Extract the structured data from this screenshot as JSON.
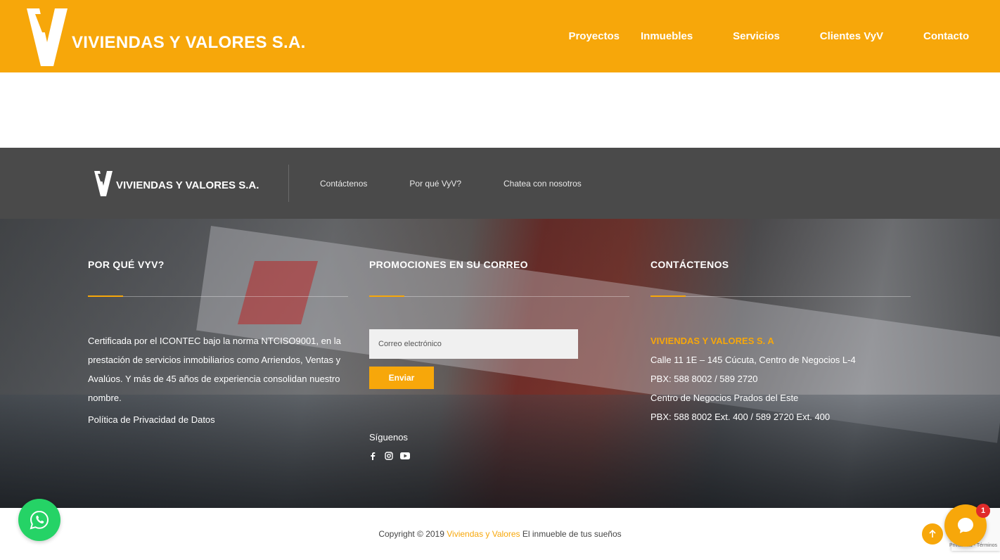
{
  "header": {
    "brand": "VIVIENDAS Y VALORES S.A.",
    "nav": [
      {
        "label": "Proyectos"
      },
      {
        "label": "Inmuebles"
      },
      {
        "label": "Servicios"
      },
      {
        "label": "Clientes VyV"
      },
      {
        "label": "Contacto"
      }
    ]
  },
  "footer_bar": {
    "brand": "VIVIENDAS Y VALORES S.A.",
    "links": [
      "Contáctenos",
      "Por qué VyV?",
      "Chatea con nosotros"
    ]
  },
  "about": {
    "title": "POR QUÉ VYV?",
    "text": "Certificada por el ICONTEC bajo la norma NTCISO9001, en la prestación de servicios inmobiliarios como Arriendos, Ventas y Avalúos. Y más de 45 años de experiencia consolidan nuestro nombre.",
    "privacy_link": "Política de Privacidad de Datos"
  },
  "newsletter": {
    "title": "PROMOCIONES EN SU CORREO",
    "email_placeholder": "Correo electrónico",
    "submit_label": "Enviar",
    "follow_label": "Síguenos",
    "socials": [
      "facebook",
      "instagram",
      "youtube"
    ]
  },
  "contact": {
    "title": "CONTÁCTENOS",
    "company": "VIVIENDAS Y VALORES S. A",
    "address": "Calle 11 1E – 145 Cúcuta, Centro de Negocios L-4",
    "phone1": "PBX: 588 8002 / 589 2720",
    "branch": "Centro de Negocios Prados del Este",
    "phone2": "PBX: 588 8002 Ext. 400 / 589 2720 Ext. 400"
  },
  "bottom": {
    "copyright_prefix": "Copyright © 2019",
    "company_link": "Viviendas y Valores",
    "copyright_suffix": "El inmueble de tus sueños",
    "chat_badge": "1",
    "recaptcha_text": "Privacidad - Términos"
  },
  "colors": {
    "accent": "#f7a70a",
    "footer_bar": "#4a4a4a",
    "whatsapp": "#25d366"
  }
}
